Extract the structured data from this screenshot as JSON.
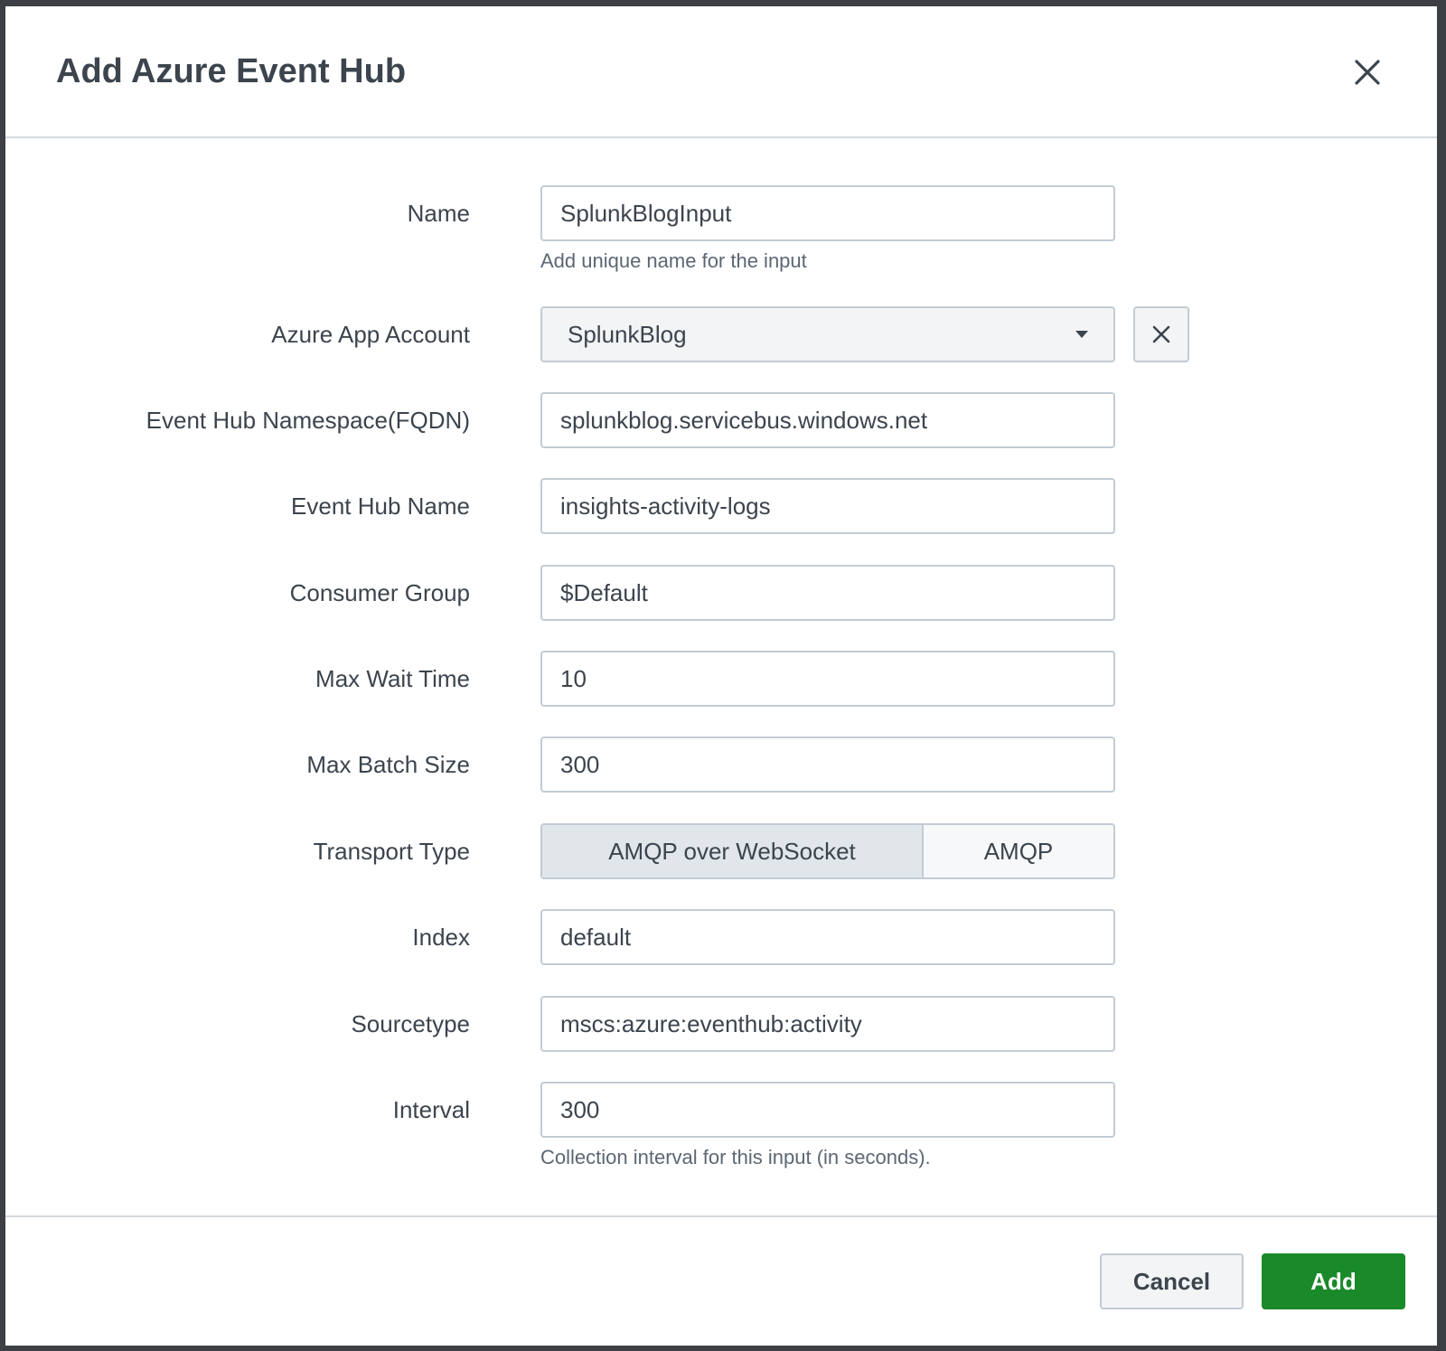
{
  "dialog": {
    "title": "Add Azure Event Hub",
    "close_icon": "close-icon"
  },
  "fields": {
    "name": {
      "label": "Name",
      "value": "SplunkBlogInput",
      "help": "Add unique name for the input"
    },
    "azure_app_account": {
      "label": "Azure App Account",
      "value": "SplunkBlog",
      "caret_icon": "chevron-down-icon",
      "clear_icon": "close-icon"
    },
    "namespace": {
      "label": "Event Hub Namespace(FQDN)",
      "value": "splunkblog.servicebus.windows.net"
    },
    "event_hub_name": {
      "label": "Event Hub Name",
      "value": "insights-activity-logs"
    },
    "consumer_group": {
      "label": "Consumer Group",
      "value": "$Default"
    },
    "max_wait_time": {
      "label": "Max Wait Time",
      "value": "10"
    },
    "max_batch_size": {
      "label": "Max Batch Size",
      "value": "300"
    },
    "transport_type": {
      "label": "Transport Type",
      "options": [
        "AMQP over WebSocket",
        "AMQP"
      ],
      "selected": "AMQP over WebSocket"
    },
    "index": {
      "label": "Index",
      "value": "default"
    },
    "sourcetype": {
      "label": "Sourcetype",
      "value": "mscs:azure:eventhub:activity"
    },
    "interval": {
      "label": "Interval",
      "value": "300",
      "help": "Collection interval for this input (in seconds)."
    }
  },
  "footer": {
    "cancel_label": "Cancel",
    "add_label": "Add"
  },
  "colors": {
    "primary_button": "#1a8929",
    "overlay": "#3c3f44",
    "input_border": "#c3cbd4",
    "active_toggle": "#e1e6eb"
  }
}
